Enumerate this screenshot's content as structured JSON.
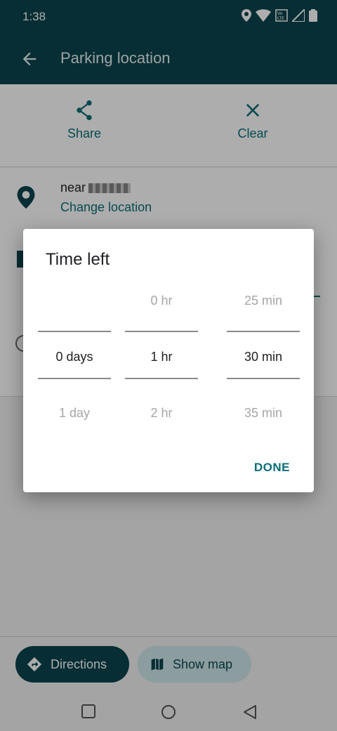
{
  "status": {
    "time": "1:38"
  },
  "appbar": {
    "title": "Parking location"
  },
  "actions": {
    "share": "Share",
    "clear": "Clear"
  },
  "location": {
    "near": "near",
    "change": "Change location"
  },
  "bottom": {
    "directions": "Directions",
    "show_map": "Show map"
  },
  "dialog": {
    "title": "Time left",
    "days": {
      "prev": "",
      "selected": "0 days",
      "next": "1 day"
    },
    "hours": {
      "prev": "0 hr",
      "selected": "1 hr",
      "next": "2 hr"
    },
    "minutes": {
      "prev": "25 min",
      "selected": "30 min",
      "next": "35 min"
    },
    "done": "DONE"
  },
  "colors": {
    "primary": "#0a444d",
    "accent": "#0a6d77",
    "tonal": "#cfe7ea"
  },
  "icons": [
    "back-arrow-icon",
    "share-icon",
    "close-icon",
    "location-pin-icon",
    "directions-icon",
    "map-icon",
    "home-nav-icon",
    "back-nav-icon",
    "recents-nav-icon"
  ]
}
